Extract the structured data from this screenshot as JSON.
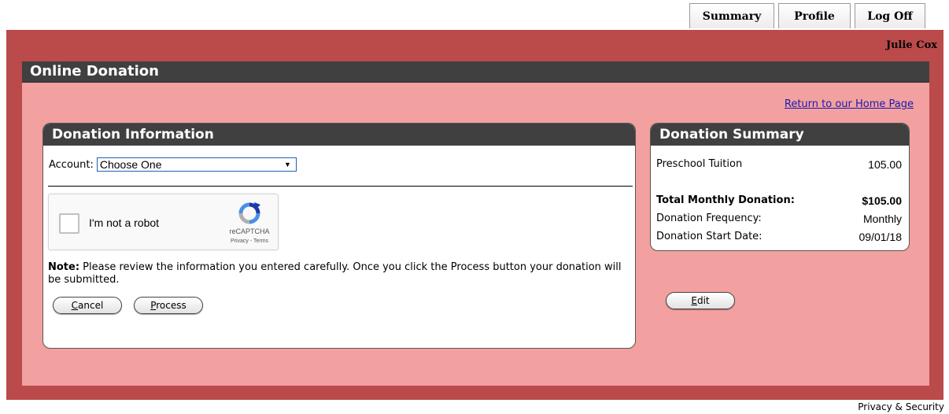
{
  "tabs": {
    "summary": "Summary",
    "profile": "Profile",
    "logoff": "Log Off"
  },
  "user": {
    "name": "Julie Cox"
  },
  "page": {
    "title": "Online Donation",
    "home_link": "Return to our Home Page"
  },
  "donation_info": {
    "title": "Donation Information",
    "account_label": "Account:",
    "account_value": "Choose One",
    "captcha": {
      "label": "I'm not a robot",
      "brand": "reCAPTCHA",
      "terms": "Privacy - Terms"
    },
    "note_bold": "Note:",
    "note_text": " Please review the information you entered carefully. Once you click the Process button your donation will be submitted.",
    "cancel_first": "C",
    "cancel_rest": "ancel",
    "process_first": "P",
    "process_rest": "rocess"
  },
  "donation_summary": {
    "title": "Donation Summary",
    "item_label": "Preschool Tuition",
    "item_value": "105.00",
    "total_label": "Total Monthly Donation:",
    "total_value": "$105.00",
    "frequency_label": "Donation Frequency:",
    "frequency_value": "Monthly",
    "start_label": "Donation Start Date:",
    "start_value": "09/01/18",
    "edit_first": "E",
    "edit_rest": "dit"
  },
  "footer": {
    "privacy": "Privacy & Security"
  },
  "colors": {
    "frame": "#bb4a4a",
    "content_bg": "#f2a0a0",
    "header_bg": "#404040"
  }
}
